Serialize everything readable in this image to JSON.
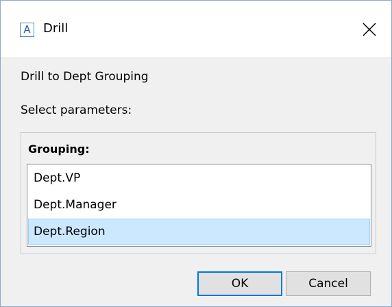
{
  "window": {
    "title": "Drill",
    "app_icon_letter": "A",
    "accent_color": "#0078d7"
  },
  "heading": "Drill to Dept Grouping",
  "subheading": "Select parameters:",
  "grouping": {
    "label": "Grouping:",
    "items": [
      {
        "label": "Dept.VP",
        "selected": false
      },
      {
        "label": "Dept.Manager",
        "selected": false
      },
      {
        "label": "Dept.Region",
        "selected": true
      }
    ],
    "selection_color": "#cce8ff"
  },
  "buttons": {
    "ok": "OK",
    "cancel": "Cancel"
  },
  "icons": {
    "app": "app-letter-a-icon",
    "close": "close-icon"
  }
}
